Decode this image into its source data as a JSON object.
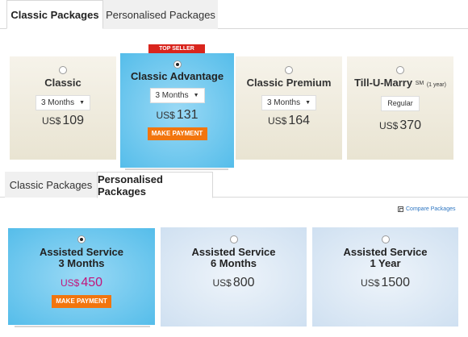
{
  "tabs_top": [
    {
      "label": "Classic Packages",
      "active": true
    },
    {
      "label": "Personalised Packages",
      "active": false
    }
  ],
  "classic_cards": [
    {
      "name": "Classic",
      "duration": "3 Months",
      "currency": "US$",
      "price": "109",
      "selected": false
    },
    {
      "name": "Classic Advantage",
      "duration": "3 Months",
      "currency": "US$",
      "price": "131",
      "selected": true,
      "badge": "TOP SELLER",
      "button": "MAKE PAYMENT"
    },
    {
      "name": "Classic Premium",
      "duration": "3 Months",
      "currency": "US$",
      "price": "164",
      "selected": false
    },
    {
      "name": "Till-U-Marry",
      "name_sup": "SM",
      "name_note": "(1 year)",
      "option": "Regular",
      "currency": "US$",
      "price": "370",
      "selected": false
    }
  ],
  "tabs_bottom": [
    {
      "label": "Classic Packages",
      "active": false
    },
    {
      "label": "Personalised Packages",
      "active": true
    }
  ],
  "compare_link": "Compare Packages",
  "personalised_cards": [
    {
      "name_line1": "Assisted Service",
      "name_line2": "3 Months",
      "currency": "US$",
      "price": "450",
      "selected": true,
      "button": "MAKE PAYMENT"
    },
    {
      "name_line1": "Assisted Service",
      "name_line2": "6 Months",
      "currency": "US$",
      "price": "800",
      "selected": false
    },
    {
      "name_line1": "Assisted Service",
      "name_line2": "1 Year",
      "currency": "US$",
      "price": "1500",
      "selected": false
    }
  ],
  "icons": {
    "dropdown_arrow": "caret-down-icon",
    "compare": "compare-icon"
  },
  "colors": {
    "accent_orange": "#f2750e",
    "selected_blue": "#55bdea",
    "ribbon_red": "#d9251d",
    "price_pink": "#c2157b",
    "link_blue": "#2e76c2"
  }
}
